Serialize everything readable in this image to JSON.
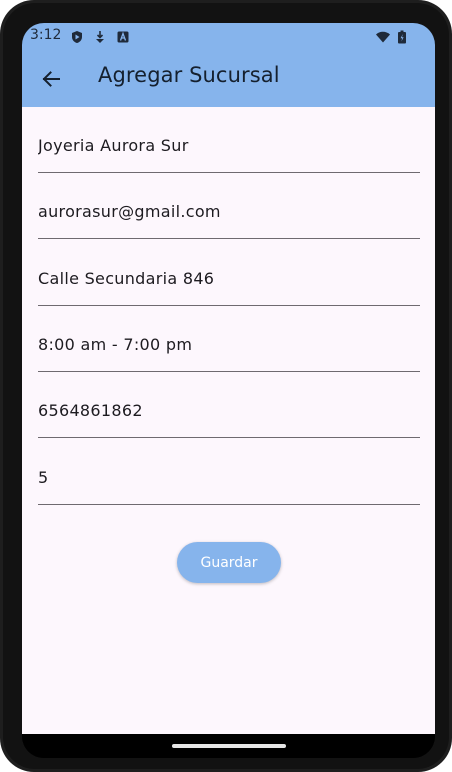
{
  "status_bar": {
    "time": "3:12",
    "left_icons": [
      "play-protect-icon",
      "download-icon",
      "keyboard-a-icon"
    ],
    "right_icons": [
      "wifi-icon",
      "battery-icon"
    ]
  },
  "app_bar": {
    "back_icon": "arrow-back-icon",
    "title": "Agregar Sucursal",
    "color": "#86b4ec"
  },
  "form": {
    "fields": [
      {
        "value": "Joyeria Aurora Sur"
      },
      {
        "value": "aurorasur@gmail.com"
      },
      {
        "value": "Calle Secundaria 846"
      },
      {
        "value": "8:00 am - 7:00 pm"
      },
      {
        "value": "6564861862"
      },
      {
        "value": "5"
      }
    ],
    "save_label": "Guardar"
  },
  "colors": {
    "background": "#fdf7fd",
    "accent": "#86b4ec",
    "text": "#1d1b20"
  }
}
